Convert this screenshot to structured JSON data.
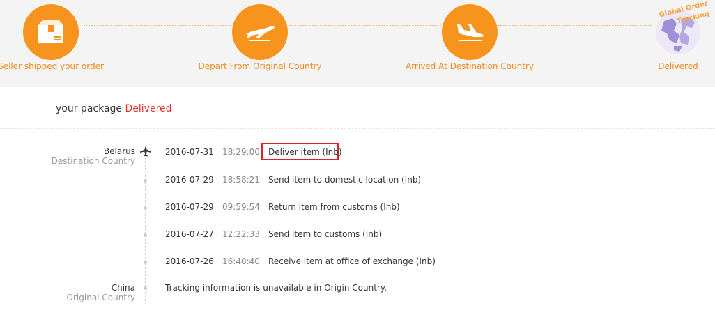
{
  "steps": [
    {
      "label": "Seller shipped your order",
      "icon": "package-icon"
    },
    {
      "label": "Depart From Original Country",
      "icon": "plane-depart-icon"
    },
    {
      "label": "Arrived At Destination Country",
      "icon": "plane-arrive-icon"
    },
    {
      "label": "Delivered",
      "icon": "globe-icon"
    }
  ],
  "globe_caption": [
    "Global Order",
    "Tracking"
  ],
  "headline": {
    "prefix": "your package",
    "status": "Delivered"
  },
  "destination": {
    "place": "Belarus",
    "role": "Destination Country"
  },
  "origin": {
    "place": "China",
    "role": "Original Country"
  },
  "events": [
    {
      "date": "2016-07-31",
      "time": "18:29:00",
      "desc": "Deliver item (Inb)"
    },
    {
      "date": "2016-07-29",
      "time": "18:58:21",
      "desc": "Send item to domestic location (Inb)"
    },
    {
      "date": "2016-07-29",
      "time": "09:59:54",
      "desc": "Return item from customs (Inb)"
    },
    {
      "date": "2016-07-27",
      "time": "12:22:33",
      "desc": "Send item to customs (Inb)"
    },
    {
      "date": "2016-07-26",
      "time": "16:40:40",
      "desc": "Receive item at office of exchange (Inb)"
    }
  ],
  "origin_note": "Tracking information is unavailable in Origin Country.",
  "colors": {
    "accent": "#f7941d",
    "status": "#e53030",
    "highlight": "#d9232d"
  }
}
